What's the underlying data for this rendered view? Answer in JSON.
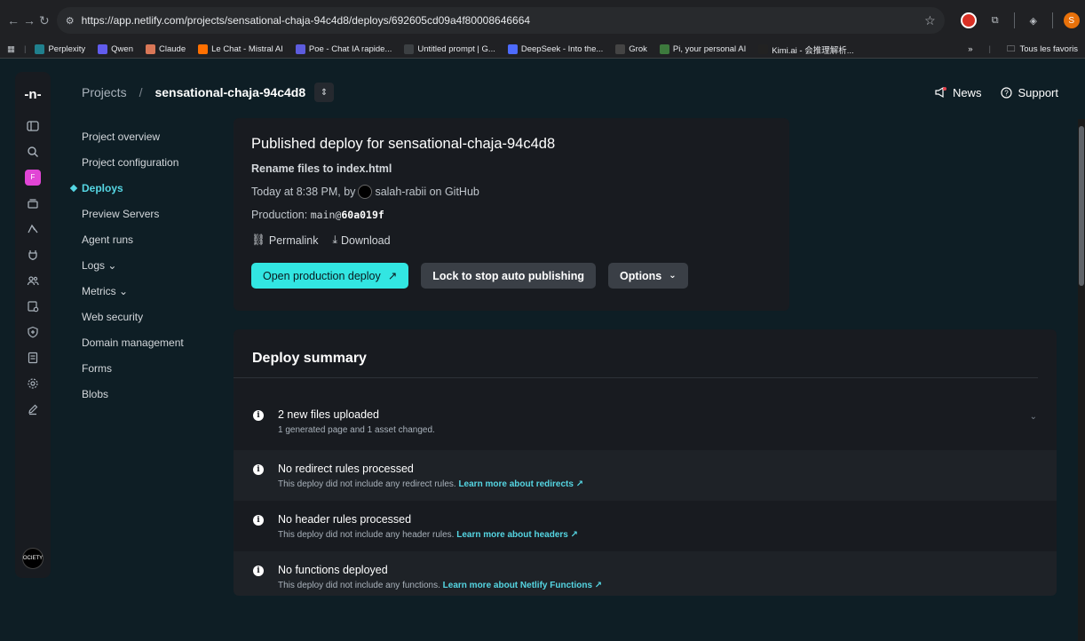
{
  "browser": {
    "url": "https://app.netlify.com/projects/sensational-chaja-94c4d8/deploys/692605cd09a4f80008646664",
    "avatar_letter": "S",
    "bookmarks": [
      {
        "label": "Perplexity",
        "color": "#20808d"
      },
      {
        "label": "Qwen",
        "color": "#615ced"
      },
      {
        "label": "Claude",
        "color": "#d97757"
      },
      {
        "label": "Le Chat - Mistral AI",
        "color": "#ff7000"
      },
      {
        "label": "Poe - Chat IA rapide...",
        "color": "#5d5cde"
      },
      {
        "label": "Untitled prompt | G...",
        "color": "#3c4043"
      },
      {
        "label": "DeepSeek - Into the...",
        "color": "#4d6bfe"
      },
      {
        "label": "Grok",
        "color": "#444444"
      },
      {
        "label": "Pi, your personal AI",
        "color": "#3d7a3d"
      },
      {
        "label": "Kimi.ai - 会推理解析...",
        "color": "#222222"
      }
    ],
    "more": "»",
    "favorites": "Tous les favoris"
  },
  "header": {
    "breadcrumb_root": "Projects",
    "breadcrumb_sep": "/",
    "project_name": "sensational-chaja-94c4d8",
    "news": "News",
    "support": "Support"
  },
  "rail": {
    "logo": "-n-",
    "team_letter": "F",
    "user_label": "OCIETY"
  },
  "subnav": [
    {
      "label": "Project overview",
      "active": false
    },
    {
      "label": "Project configuration",
      "active": false
    },
    {
      "label": "Deploys",
      "active": true
    },
    {
      "label": "Preview Servers",
      "active": false
    },
    {
      "label": "Agent runs",
      "active": false
    },
    {
      "label": "Logs ⌄",
      "active": false
    },
    {
      "label": "Metrics ⌄",
      "active": false
    },
    {
      "label": "Web security",
      "active": false
    },
    {
      "label": "Domain management",
      "active": false
    },
    {
      "label": "Forms",
      "active": false
    },
    {
      "label": "Blobs",
      "active": false
    }
  ],
  "deploy": {
    "title": "Published deploy for sensational-chaja-94c4d8",
    "commit_message": "Rename files to index.html",
    "time_prefix": "Today at 8:38 PM, by",
    "author": "salah-rabii on GitHub",
    "production_label": "Production:",
    "branch": "main@",
    "sha": "60a019f",
    "permalink": "Permalink",
    "download": "Download",
    "open_btn": "Open production deploy",
    "lock_btn": "Lock to stop auto publishing",
    "options_btn": "Options"
  },
  "summary": {
    "title": "Deploy summary",
    "rows": [
      {
        "head": "2 new files uploaded",
        "desc": "1 generated page and 1 asset changed.",
        "link": ""
      },
      {
        "head": "No redirect rules processed",
        "desc": "This deploy did not include any redirect rules.",
        "link": "Learn more about redirects"
      },
      {
        "head": "No header rules processed",
        "desc": "This deploy did not include any header rules.",
        "link": "Learn more about headers"
      },
      {
        "head": "No functions deployed",
        "desc": "This deploy did not include any functions.",
        "link": "Learn more about Netlify Functions"
      }
    ]
  },
  "colors": {
    "accent": "#32e6e2",
    "active_nav": "#55d6e3",
    "card_bg": "#181b20",
    "page_bg": "#0e1e25"
  }
}
